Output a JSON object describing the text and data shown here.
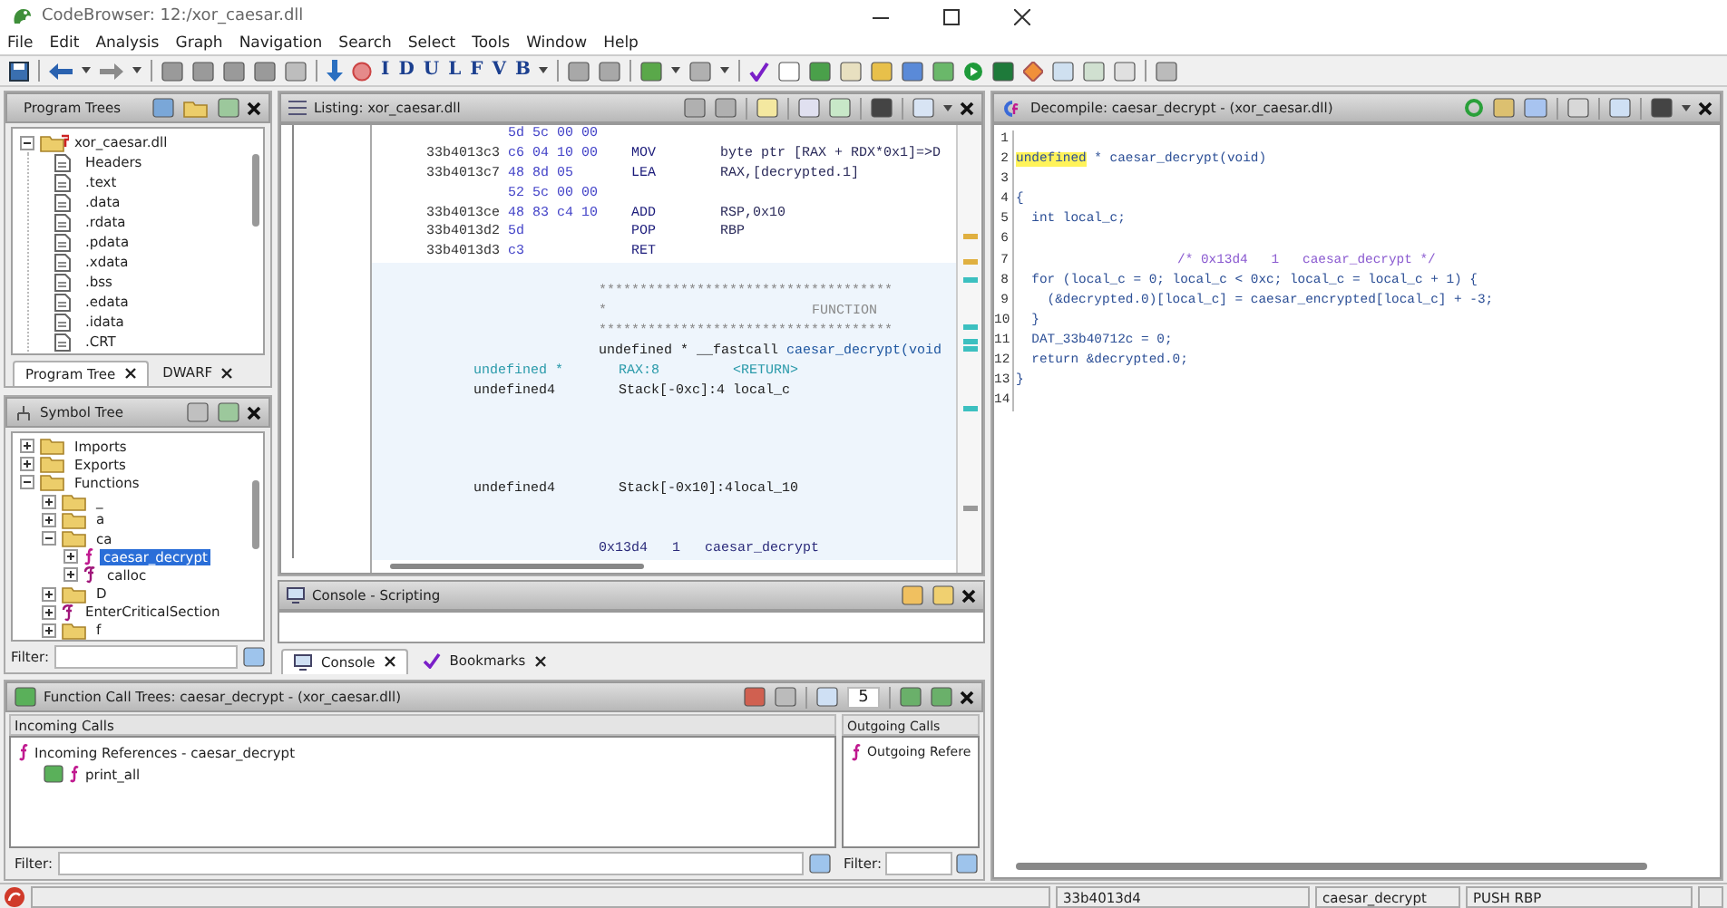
{
  "window": {
    "title": "CodeBrowser: 12:/xor_caesar.dll"
  },
  "menu": [
    "File",
    "Edit",
    "Analysis",
    "Graph",
    "Navigation",
    "Search",
    "Select",
    "Tools",
    "Window",
    "Help"
  ],
  "toolbar": {
    "letter_buttons": [
      "I",
      "D",
      "U",
      "L",
      "F",
      "V",
      "B"
    ]
  },
  "program_trees": {
    "title": "Program Trees",
    "root": {
      "label": "xor_caesar.dll",
      "expanded": true,
      "children": [
        "Headers",
        ".text",
        ".data",
        ".rdata",
        ".pdata",
        ".xdata",
        ".bss",
        ".edata",
        ".idata",
        ".CRT"
      ]
    },
    "tabs": [
      {
        "label": "Program Tree",
        "selected": true
      },
      {
        "label": "DWARF",
        "selected": false
      }
    ]
  },
  "symbol_tree": {
    "title": "Symbol Tree",
    "items": [
      {
        "kind": "folder",
        "label": "Imports",
        "expanded": false,
        "selected": false
      },
      {
        "kind": "folder",
        "label": "Exports",
        "expanded": false,
        "selected": false
      },
      {
        "kind": "folder",
        "label": "Functions",
        "expanded": true,
        "selected": false,
        "children": [
          {
            "kind": "folder",
            "label": "_",
            "expanded": false,
            "selected": false
          },
          {
            "kind": "folder",
            "label": "a",
            "expanded": false,
            "selected": false
          },
          {
            "kind": "folder",
            "label": "ca",
            "expanded": true,
            "selected": false,
            "children": [
              {
                "kind": "function",
                "label": "caesar_decrypt",
                "expanded": false,
                "selected": true
              },
              {
                "kind": "external",
                "label": "calloc",
                "expanded": false,
                "selected": false
              }
            ]
          },
          {
            "kind": "folder",
            "label": "D",
            "expanded": false,
            "selected": false
          },
          {
            "kind": "external",
            "label": "EnterCriticalSection",
            "expanded": false,
            "selected": false
          },
          {
            "kind": "folder",
            "label": "f",
            "expanded": false,
            "selected": false
          }
        ]
      }
    ],
    "filter_label": "Filter:"
  },
  "listing": {
    "title": "Listing:  xor_caesar.dll",
    "blocks": [
      {
        "kind": "instructions",
        "lines": [
          {
            "kind": "code",
            "bytes": "5d 5c 00 00"
          },
          {
            "kind": "code",
            "address": "33b4013c3",
            "bytes": "c6 04 10 00",
            "mnemonic": "MOV",
            "operands": "byte ptr [RAX + RDX*0x1]=>D"
          },
          {
            "kind": "code",
            "address": "33b4013c7",
            "bytes": "48 8d 05",
            "mnemonic": "LEA",
            "operands": "RAX,[decrypted.1]"
          },
          {
            "kind": "code",
            "bytes": "52 5c 00 00"
          },
          {
            "kind": "code",
            "address": "33b4013ce",
            "bytes": "48 83 c4 10",
            "mnemonic": "ADD",
            "operands": "RSP,0x10"
          },
          {
            "kind": "code",
            "address": "33b4013d2",
            "bytes": "5d",
            "mnemonic": "POP",
            "operands": "RBP"
          },
          {
            "kind": "code",
            "address": "33b4013d3",
            "bytes": "c3",
            "mnemonic": "RET"
          }
        ]
      },
      {
        "kind": "function_header",
        "lines": [
          {
            "kind": "blank"
          },
          {
            "kind": "stars",
            "text": "************************************"
          },
          {
            "kind": "banner",
            "mark": "*",
            "text": "FUNCTION"
          },
          {
            "kind": "stars",
            "text": "************************************"
          },
          {
            "kind": "signature",
            "prefix": "undefined * __fastcall",
            "name": "caesar_decrypt(void"
          },
          {
            "kind": "return",
            "type": "undefined *",
            "location": "RAX:8",
            "name": "<RETURN>"
          },
          {
            "kind": "local",
            "type": "undefined4",
            "location": "Stack[-0xc]:4",
            "name": "local_c"
          },
          {
            "kind": "blank"
          },
          {
            "kind": "blank"
          },
          {
            "kind": "blank"
          },
          {
            "kind": "blank"
          },
          {
            "kind": "local",
            "type": "undefined4",
            "location": "Stack[-0x10]:4",
            "name": "local_10"
          },
          {
            "kind": "blank"
          },
          {
            "kind": "blank"
          },
          {
            "kind": "label",
            "text": "0x13d4   1   caesar_decrypt"
          }
        ]
      }
    ]
  },
  "console": {
    "title": "Console - Scripting",
    "tabs": [
      {
        "label": "Console",
        "selected": true
      },
      {
        "label": "Bookmarks",
        "selected": false
      }
    ]
  },
  "decompiler": {
    "title": "Decompile: caesar_decrypt -  (xor_caesar.dll)",
    "lines": [
      {
        "number": "1",
        "kind": "code"
      },
      {
        "number": "2",
        "kind": "code",
        "segments": [
          {
            "text": "undefined",
            "highlighted": true
          },
          {
            "text": " * caesar_decrypt(void)",
            "highlighted": false
          }
        ]
      },
      {
        "number": "3",
        "kind": "code"
      },
      {
        "number": "4",
        "kind": "code",
        "segments": [
          {
            "text": "{",
            "highlighted": false
          }
        ]
      },
      {
        "number": "5",
        "kind": "code",
        "segments": [
          {
            "text": "  int local_c;",
            "highlighted": false
          }
        ]
      },
      {
        "number": "6",
        "kind": "code"
      },
      {
        "number": "7",
        "kind": "comment",
        "segments": [
          {
            "text": "/* 0x13d4   1   caesar_decrypt */",
            "highlighted": false
          }
        ]
      },
      {
        "number": "8",
        "kind": "code",
        "segments": [
          {
            "text": "  for (local_c = 0; local_c < 0xc; local_c = local_c + 1) {",
            "highlighted": false
          }
        ]
      },
      {
        "number": "9",
        "kind": "code",
        "segments": [
          {
            "text": "    (&decrypted.0)[local_c] = caesar_encrypted[local_c] + -3;",
            "highlighted": false
          }
        ]
      },
      {
        "number": "10",
        "kind": "code",
        "segments": [
          {
            "text": "  }",
            "highlighted": false
          }
        ]
      },
      {
        "number": "11",
        "kind": "code",
        "segments": [
          {
            "text": "  DAT_33b40712c = 0;",
            "highlighted": false
          }
        ]
      },
      {
        "number": "12",
        "kind": "code",
        "segments": [
          {
            "text": "  return &decrypted.0;",
            "highlighted": false
          }
        ]
      },
      {
        "number": "13",
        "kind": "code",
        "segments": [
          {
            "text": "}",
            "highlighted": false
          }
        ]
      },
      {
        "number": "14",
        "kind": "code"
      }
    ]
  },
  "call_trees": {
    "title": "Function Call Trees: caesar_decrypt -  (xor_caesar.dll)",
    "depth": "5",
    "incoming": {
      "heading": "Incoming Calls",
      "root": "Incoming References - caesar_decrypt",
      "children": [
        "print_all"
      ]
    },
    "outgoing": {
      "heading": "Outgoing Calls",
      "root": "Outgoing Refere",
      "filter_label": "Filter:"
    },
    "filter_label": "Filter:"
  },
  "status_bar": {
    "fields": [
      "33b4013d4",
      "caesar_decrypt",
      "PUSH RBP"
    ]
  }
}
